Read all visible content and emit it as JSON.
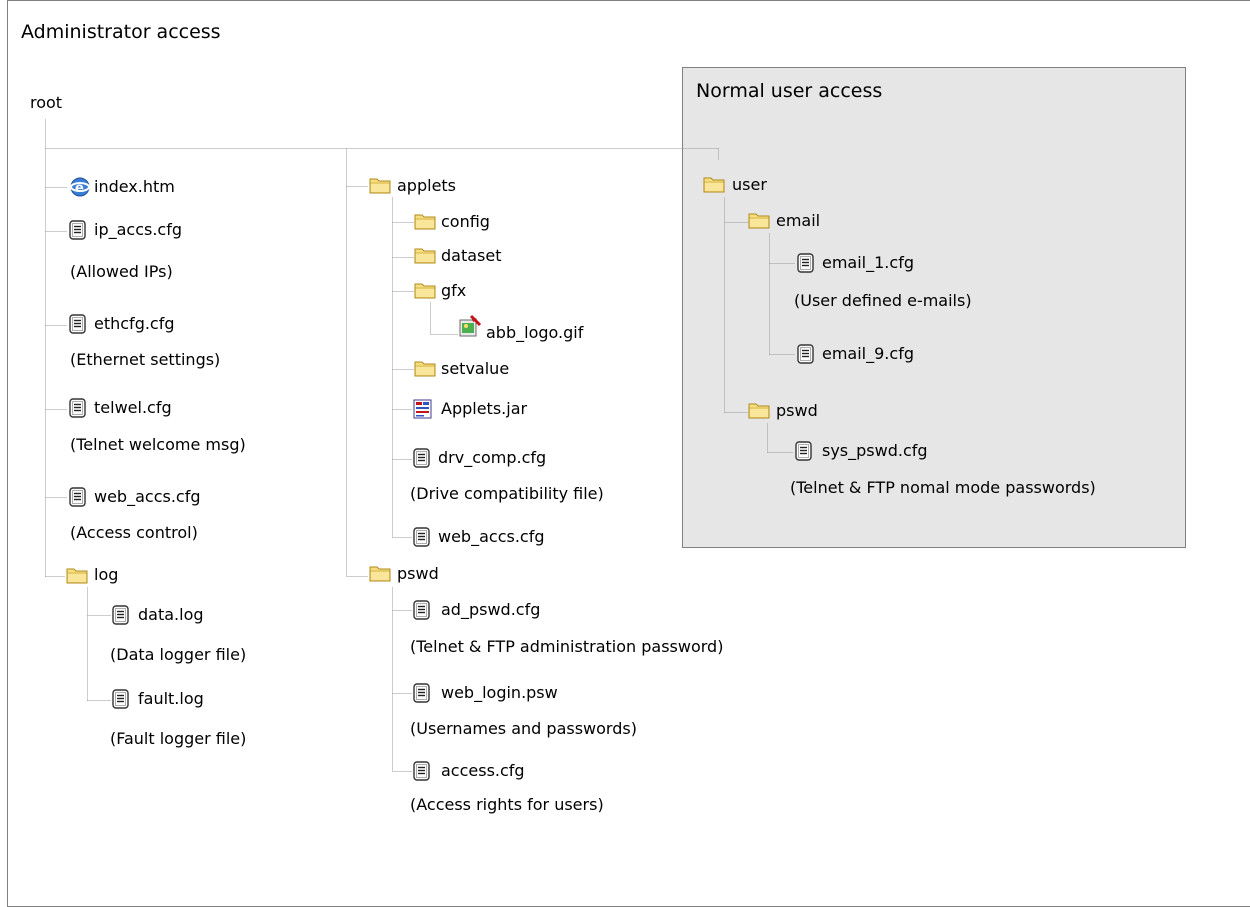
{
  "admin_title": "Administrator access",
  "normal_title": "Normal user access",
  "root_label": "root",
  "colors": {
    "frame_border": "#808080",
    "user_area_bg": "#e6e6e6",
    "tree_line": "#999999",
    "folder_fill": "#f6de7e",
    "folder_stroke": "#b08a1c"
  },
  "root_files": {
    "index": "index.htm",
    "ip_accs": "ip_accs.cfg",
    "ip_accs_note": "(Allowed IPs)",
    "ethcfg": "ethcfg.cfg",
    "ethcfg_note": "(Ethernet settings)",
    "telwel": "telwel.cfg",
    "telwel_note": "(Telnet welcome msg)",
    "web_accs": "web_accs.cfg",
    "web_accs_note": "(Access control)"
  },
  "log": {
    "folder": "log",
    "data": "data.log",
    "data_note": "(Data logger file)",
    "fault": "fault.log",
    "fault_note": "(Fault logger file)"
  },
  "applets": {
    "folder": "applets",
    "config": "config",
    "dataset": "dataset",
    "gfx": "gfx",
    "abb_logo": "abb_logo.gif",
    "setvalue": "setvalue",
    "jar": "Applets.jar",
    "drv_comp": "drv_comp.cfg",
    "drv_comp_note": "(Drive compatibility file)",
    "web_accs": "web_accs.cfg"
  },
  "admin_pswd": {
    "folder": "pswd",
    "ad_pswd": "ad_pswd.cfg",
    "ad_pswd_note": "(Telnet & FTP administration password)",
    "web_login": "web_login.psw",
    "web_login_note": "(Usernames and passwords)",
    "access": "access.cfg",
    "access_note": "(Access rights for users)"
  },
  "user": {
    "folder": "user",
    "email_folder": "email",
    "email_1": "email_1.cfg",
    "email_note": "(User defined e-mails)",
    "email_9": "email_9.cfg",
    "pswd_folder": "pswd",
    "sys_pswd": "sys_pswd.cfg",
    "sys_pswd_note": "(Telnet & FTP nomal mode passwords)"
  }
}
